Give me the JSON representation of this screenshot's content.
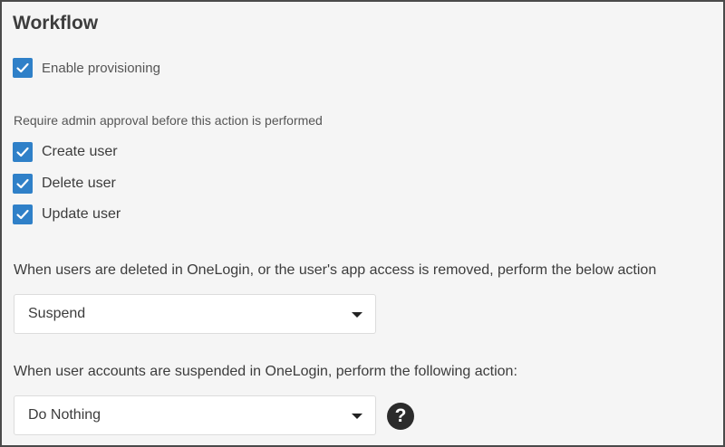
{
  "section": {
    "title": "Workflow"
  },
  "provisioning": {
    "label": "Enable provisioning",
    "checked": true
  },
  "approval": {
    "heading": "Require admin approval before this action is performed",
    "items": [
      {
        "label": "Create user",
        "checked": true
      },
      {
        "label": "Delete user",
        "checked": true
      },
      {
        "label": "Update user",
        "checked": true
      }
    ]
  },
  "on_delete": {
    "text": "When users are deleted in OneLogin, or the user's app access is removed, perform the below action",
    "selected": "Suspend"
  },
  "on_suspend": {
    "text": "When user accounts are suspended in OneLogin, perform the following action:",
    "selected": "Do Nothing"
  },
  "help": {
    "glyph": "?"
  },
  "colors": {
    "checkbox": "#2f80c8",
    "background": "#f5f5f5"
  }
}
